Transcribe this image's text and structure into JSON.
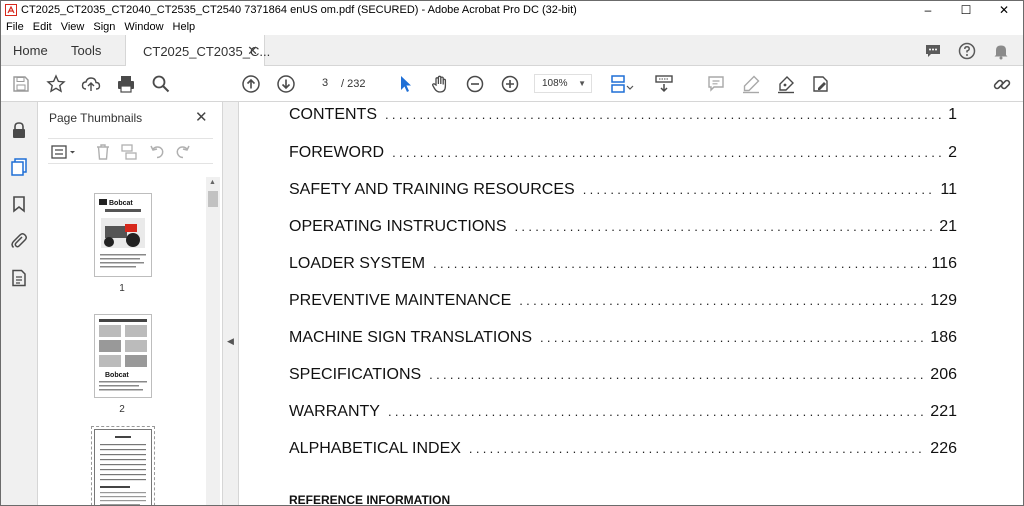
{
  "window": {
    "title": "CT2025_CT2035_CT2040_CT2535_CT2540 7371864 enUS om.pdf (SECURED) - Adobe Acrobat Pro DC (32-bit)",
    "minimize": "–",
    "maximize": "☐",
    "close": "✕"
  },
  "menu": [
    "File",
    "Edit",
    "View",
    "Sign",
    "Window",
    "Help"
  ],
  "tabs": {
    "home": "Home",
    "tools": "Tools",
    "document": "CT2025_CT2035_C...",
    "close": "✕"
  },
  "toolbar": {
    "page_current": "3",
    "page_total": "/  232",
    "zoom": "108%"
  },
  "thumbnails": {
    "title": "Page Thumbnails",
    "close": "✕",
    "pages": [
      {
        "label": "1"
      },
      {
        "label": "2"
      },
      {
        "label": ""
      }
    ]
  },
  "document": {
    "toc": [
      {
        "title": "CONTENTS",
        "page": "1"
      },
      {
        "title": "FOREWORD",
        "page": "2"
      },
      {
        "title": "SAFETY AND TRAINING RESOURCES",
        "page": "11"
      },
      {
        "title": "OPERATING INSTRUCTIONS",
        "page": "21"
      },
      {
        "title": "LOADER SYSTEM",
        "page": "116"
      },
      {
        "title": "PREVENTIVE MAINTENANCE",
        "page": "129"
      },
      {
        "title": "MACHINE SIGN TRANSLATIONS",
        "page": "186"
      },
      {
        "title": "SPECIFICATIONS",
        "page": "206"
      },
      {
        "title": "WARRANTY",
        "page": "221"
      },
      {
        "title": "ALPHABETICAL INDEX",
        "page": "226"
      }
    ],
    "section_heading": "REFERENCE INFORMATION"
  },
  "colors": {
    "accent_blue": "#1f6fd6",
    "icon_gray": "#5a5a5a",
    "acrobat_red": "#d7281c"
  }
}
